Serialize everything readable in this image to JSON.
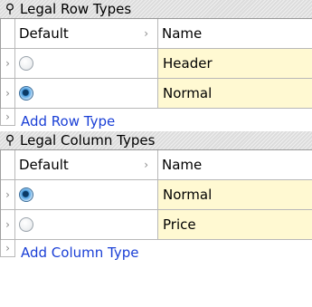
{
  "sections": [
    {
      "title": "Legal Row Types",
      "pin_icon": "pin-icon",
      "headers": {
        "default": "Default",
        "name": "Name"
      },
      "rows": [
        {
          "name": "Header",
          "default": false
        },
        {
          "name": "Normal",
          "default": true
        }
      ],
      "add_label": "Add Row Type"
    },
    {
      "title": "Legal Column Types",
      "pin_icon": "pin-icon",
      "headers": {
        "default": "Default",
        "name": "Name"
      },
      "rows": [
        {
          "name": "Normal",
          "default": true
        },
        {
          "name": "Price",
          "default": false
        }
      ],
      "add_label": "Add Column Type"
    }
  ],
  "colors": {
    "name_cell_bg": "#fff9d2",
    "link": "#1a3fd6",
    "header_bg": "#dcdcdc"
  }
}
